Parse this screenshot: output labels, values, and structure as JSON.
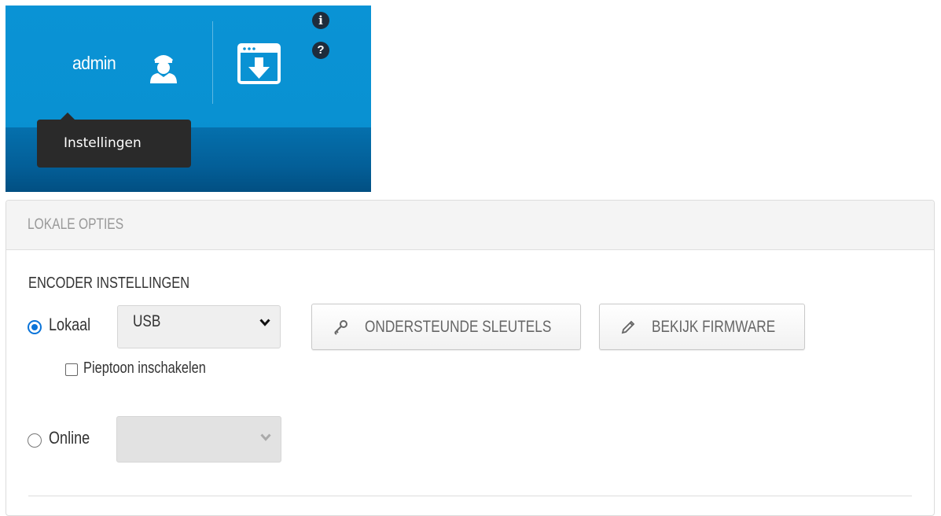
{
  "header": {
    "username": "admin",
    "icons": [
      "user-icon",
      "download-icon",
      "info-icon",
      "help-icon"
    ],
    "info_glyph": "i",
    "help_glyph": "?",
    "tooltip": "Instellingen",
    "colors": {
      "bar_top": "#0a93d5",
      "bar_bottom": "#035f98",
      "tooltip_bg": "#2a2a2a"
    }
  },
  "panel": {
    "title": "LOKALE OPTIES",
    "section_title": "ENCODER INSTELLINGEN",
    "local": {
      "label": "Lokaal",
      "selected": true,
      "select_value": "USB",
      "beep_label": "Pieptoon inschakelen",
      "beep_checked": false
    },
    "online": {
      "label": "Online",
      "selected": false,
      "select_value": ""
    },
    "buttons": {
      "keys": "ONDERSTEUNDE SLEUTELS",
      "firmware": "BEKIJK FIRMWARE"
    },
    "accent_color": "#0a74d9"
  }
}
